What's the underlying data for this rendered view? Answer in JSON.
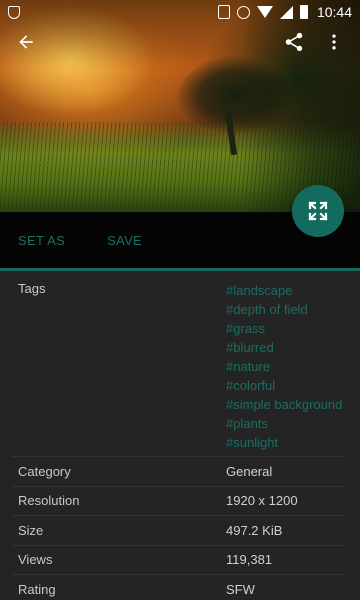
{
  "status_bar": {
    "time": "10:44",
    "icons": [
      "shield-notification-icon",
      "vibrate-icon",
      "alarm-icon",
      "wifi-icon",
      "signal-icon",
      "battery-icon"
    ]
  },
  "toolbar": {
    "back_icon": "arrow-back-icon",
    "share_icon": "share-icon",
    "more_icon": "more-vert-icon"
  },
  "fab": {
    "icon": "fullscreen-icon"
  },
  "actions": {
    "set_as_label": "SET AS",
    "save_label": "SAVE"
  },
  "colors": {
    "accent": "#176a5e",
    "tag_text": "#1a6e62",
    "background": "#242424"
  },
  "details": {
    "tags_label": "Tags",
    "tags": [
      "#landscape",
      "#depth of field",
      "#grass",
      "#blurred",
      "#nature",
      "#colorful",
      "#simple background",
      "#plants",
      "#sunlight"
    ],
    "rows": [
      {
        "label": "Category",
        "value": "General"
      },
      {
        "label": "Resolution",
        "value": "1920 x 1200"
      },
      {
        "label": "Size",
        "value": "497.2 KiB"
      },
      {
        "label": "Views",
        "value": "119,381"
      },
      {
        "label": "Rating",
        "value": "SFW"
      }
    ]
  }
}
